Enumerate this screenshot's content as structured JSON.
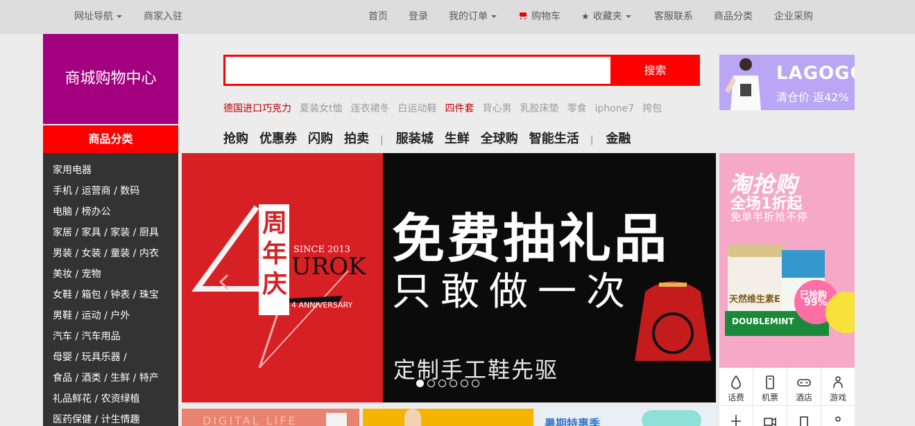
{
  "topbar": {
    "site_nav": "网址导航",
    "merchant": "商家入驻",
    "home": "首页",
    "login": "登录",
    "my_orders": "我的订单",
    "cart": "购物车",
    "favorites": "收藏夹",
    "service": "客服联系",
    "categories": "商品分类",
    "enterprise": "企业采购"
  },
  "logo": {
    "text": "商城购物中心"
  },
  "category": {
    "title": "商品分类",
    "items": [
      "家用电器",
      "手机 / 运营商 / 数码",
      "电脑 / 榜办公",
      "家居 / 家具 / 家装 / 厨具",
      "男装 / 女装 / 童装 / 内衣",
      "美妆 / 宠物",
      "女鞋 / 箱包 / 钟表 / 珠宝",
      "男鞋 / 运动 / 户外",
      "汽车 / 汽车用品",
      "母婴 / 玩具乐器 /",
      "食品 / 酒类 / 生鲜 / 特产",
      "礼品鲜花 / 农资绿植",
      "医药保健 / 计生情趣"
    ]
  },
  "search": {
    "value": "",
    "placeholder": "",
    "button": "搜索"
  },
  "hot_keywords": [
    "德国进口巧克力",
    "夏装女t恤",
    "连衣裙冬",
    "白运动鞋",
    "四件套",
    "背心男",
    "乳胶床垫",
    "零食",
    "iphone7",
    "挎包"
  ],
  "nav": {
    "group1": [
      "抢购",
      "优惠券",
      "闪购",
      "拍卖"
    ],
    "group2": [
      "服装城",
      "生鲜",
      "全球购",
      "智能生活"
    ],
    "group3": [
      "金融"
    ],
    "separator": "|"
  },
  "right_ad": {
    "brand": "LAGOGO",
    "sub": "清仓价 返42%"
  },
  "banner": {
    "headline": "免费抽礼品",
    "subline": "只敢做一次",
    "tagline": "定制手工鞋先驱",
    "anniv_chars": [
      "周",
      "年",
      "庆"
    ],
    "since": "SINCE 2013",
    "brand": "UROK",
    "anniversary": "4 ANNIVERSARY",
    "number": "4",
    "dots_total": 6,
    "dots_active_index": 0
  },
  "promo": {
    "title": "淘抢购",
    "sub": "全场1折起",
    "note": "免单半折抢不停",
    "sticker": "已抢购",
    "percent": "99%",
    "product": "DOUBLEMINT",
    "bottle": "天然维生素E"
  },
  "services": [
    {
      "label": "话费",
      "icon": "drop-icon"
    },
    {
      "label": "机票",
      "icon": "phone-icon"
    },
    {
      "label": "酒店",
      "icon": "gamepad-icon"
    },
    {
      "label": "游戏",
      "icon": "users-icon"
    }
  ],
  "thumbs": {
    "a": "DIGITAL LIFE",
    "c": "暑期特惠季"
  },
  "colors": {
    "accent": "#ff0000",
    "logo_bg": "#a3007f",
    "sidebar_bg": "#333333",
    "banner_red": "#d62024"
  }
}
